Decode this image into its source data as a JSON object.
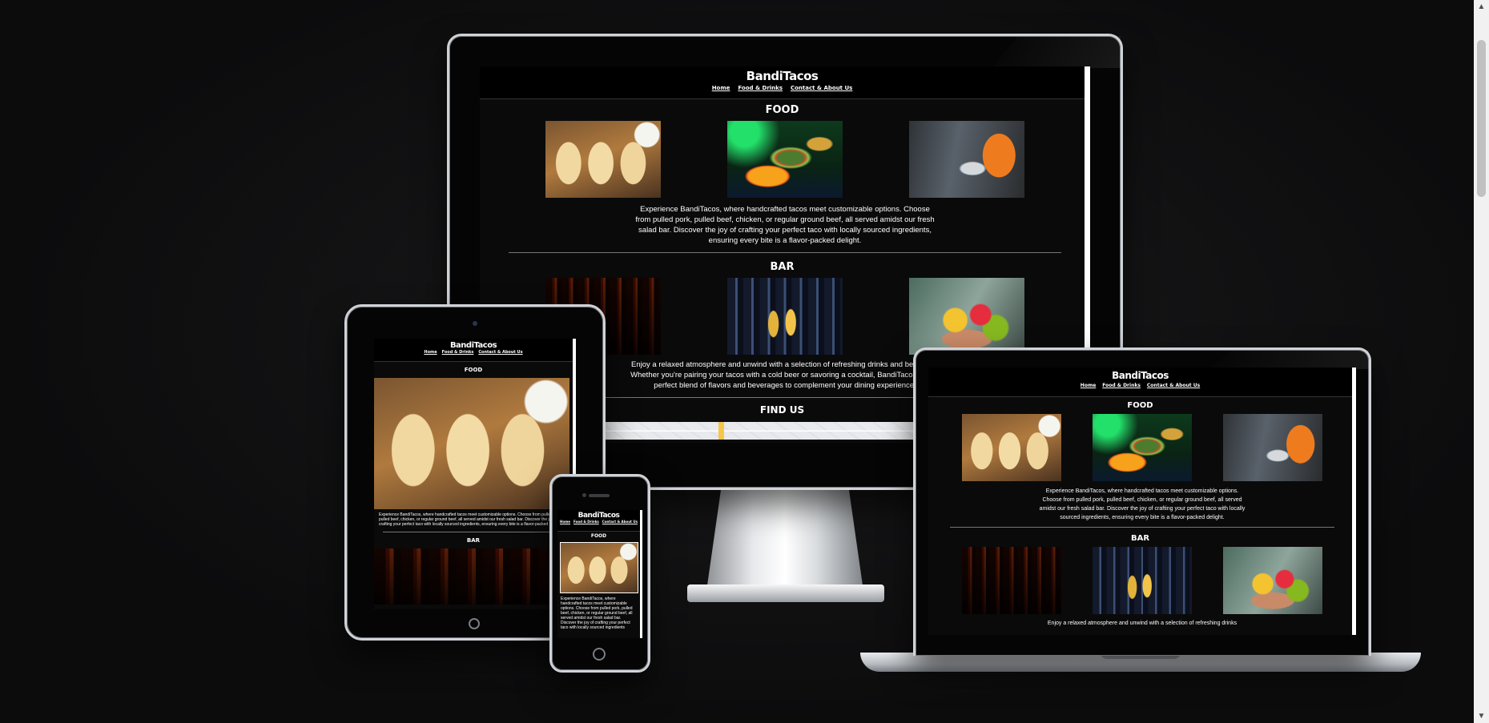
{
  "site": {
    "logo": "BandiTacos",
    "nav": [
      "Home",
      "Food & Drinks",
      "Contact & About Us"
    ],
    "sections": {
      "food": {
        "title": "FOOD",
        "text": "Experience BandiTacos, where handcrafted tacos meet customizable options. Choose from pulled pork, pulled beef, chicken, or regular ground beef, all served amidst our fresh salad bar. Discover the joy of crafting your perfect taco with locally sourced ingredients, ensuring every bite is a flavor-packed delight.",
        "images": [
          "tacos-photo",
          "salad-bar-photo",
          "serving-photo"
        ]
      },
      "bar": {
        "title": "BAR",
        "text_desktop": "Enjoy a relaxed atmosphere and unwind with a selection of refreshing drinks and beers at o",
        "text_desktop_2": "Whether you're pairing your tacos with a cold beer or savoring a cocktail, BandiTacos provid",
        "text_desktop_3": "perfect blend of flavors and beverages to complement your dining experience.",
        "text_laptop": "Enjoy a relaxed atmosphere and unwind with a selection of refreshing drinks",
        "images": [
          "wine-glasses-photo",
          "beer-glasses-photo",
          "cocktails-photo"
        ]
      },
      "find_us": {
        "title": "FIND US"
      }
    },
    "tablet_food_text": "Experience BandiTacos, where handcrafted tacos meet customizable options. Choose from pulled pork, pulled beef, chicken, or regular ground beef, all served amidst our fresh salad bar. Discover the joy of crafting your perfect taco with locally sourced ingredients, ensuring every bite is a flavor-packed",
    "phone_food_text": "Experience BandiTacos, where handcrafted tacos meet customizable options. Choose from pulled pork, pulled beef, chicken, or regular ground beef, all served amidst our fresh salad bar. Discover the joy of crafting your perfect taco with locally sourced ingredients"
  },
  "colors": {
    "page_bg": "#0e0e0f",
    "site_bg": "#0a0a0a",
    "header_bg": "#000000",
    "text": "#ffffff",
    "bezel_edge": "#cfd2d6"
  }
}
